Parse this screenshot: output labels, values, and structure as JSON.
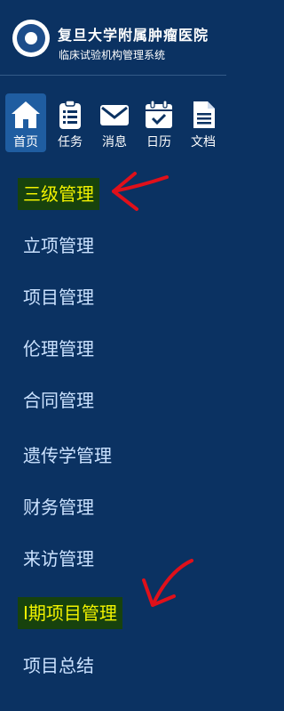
{
  "header": {
    "hospital_name": "复旦大学附属肿瘤医院",
    "system_name": "临床试验机构管理系统"
  },
  "nav": [
    {
      "label": "首页",
      "icon": "home-icon"
    },
    {
      "label": "任务",
      "icon": "clipboard-icon"
    },
    {
      "label": "消息",
      "icon": "envelope-icon"
    },
    {
      "label": "日历",
      "icon": "calendar-icon"
    },
    {
      "label": "文档",
      "icon": "document-icon"
    }
  ],
  "menu": [
    {
      "label": "三级管理"
    },
    {
      "label": "立项管理"
    },
    {
      "label": "项目管理"
    },
    {
      "label": "伦理管理"
    },
    {
      "label": "合同管理"
    },
    {
      "label": "遗传学管理"
    },
    {
      "label": "财务管理"
    },
    {
      "label": "来访管理"
    },
    {
      "label": "Ⅰ期项目管理"
    },
    {
      "label": "项目总结"
    }
  ],
  "colors": {
    "background": "#0b3262",
    "active_nav": "#1f5da1",
    "menu_text": "#cbe2ff",
    "highlight_bg": "#17420d",
    "highlight_text": "#f2f200",
    "annotation_arrow": "#e0101a"
  }
}
